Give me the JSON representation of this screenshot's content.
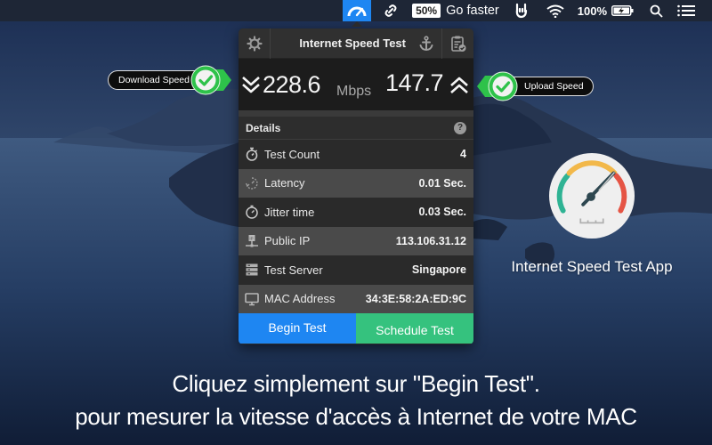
{
  "menubar": {
    "speed_icon": "speedometer-icon",
    "link_icon": "link-icon",
    "badge": "50%",
    "badge_label": "Go faster",
    "rock_icon": "rock-hand-icon",
    "wifi_icon": "wifi-icon",
    "battery_percent": "100%",
    "battery_icon": "battery-charging-icon",
    "search_icon": "search-icon",
    "list_icon": "list-icon",
    "accent_color": "#1e86f2"
  },
  "panel": {
    "title": "Internet Speed Test",
    "settings_icon": "gear-icon",
    "anchor_icon": "anchor-icon",
    "clipboard_icon": "clipboard-check-icon",
    "download_value": "228.6",
    "upload_value": "147.7",
    "unit": "Mbps",
    "details_heading": "Details",
    "help": "?",
    "rows": [
      {
        "icon": "stopwatch-icon",
        "label": "Test Count",
        "value": "4"
      },
      {
        "icon": "latency-icon",
        "label": "Latency",
        "value": "0.01 Sec."
      },
      {
        "icon": "timer-icon",
        "label": "Jitter time",
        "value": "0.03 Sec."
      },
      {
        "icon": "network-ip-icon",
        "label": "Public IP",
        "value": "113.106.31.12"
      },
      {
        "icon": "server-icon",
        "label": "Test Server",
        "value": "Singapore"
      },
      {
        "icon": "monitor-icon",
        "label": "MAC Address",
        "value": "34:3E:58:2A:ED:9C"
      }
    ],
    "begin_button": "Begin Test",
    "schedule_button": "Schedule Test",
    "begin_color": "#1e86f2",
    "schedule_color": "#35c27e"
  },
  "callouts": {
    "download": "Download Speed",
    "upload": "Upload Speed",
    "check_color": "#2ec24a"
  },
  "app": {
    "name": "Internet Speed Test App"
  },
  "caption": {
    "line1": "Cliquez simplement sur \"Begin Test\".",
    "line2": "pour mesurer la vitesse d'accès à Internet de votre MAC"
  }
}
